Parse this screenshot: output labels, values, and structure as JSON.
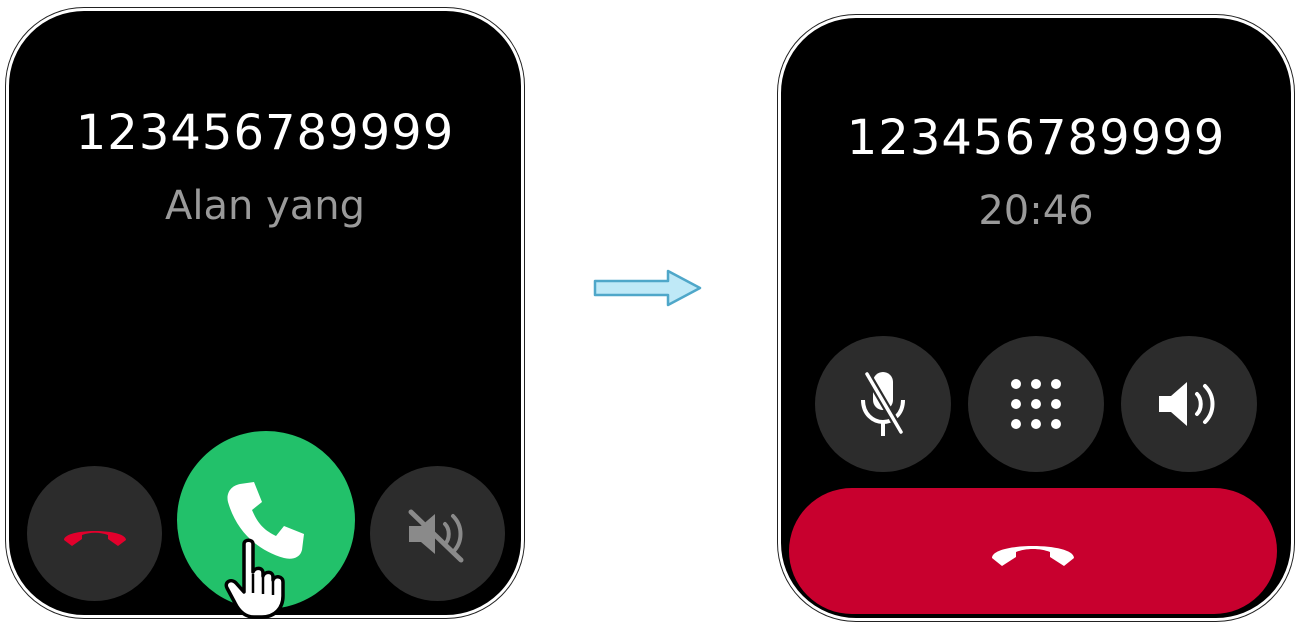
{
  "incoming_call": {
    "number": "123456789999",
    "caller_name": "Alan yang",
    "buttons": {
      "decline_icon": "phone-hangup-icon",
      "answer_icon": "phone-icon",
      "silence_icon": "speaker-muted-icon"
    }
  },
  "active_call": {
    "number": "123456789999",
    "duration": "20:46",
    "buttons": {
      "mute_icon": "microphone-muted-icon",
      "keypad_icon": "dialpad-icon",
      "speaker_icon": "speaker-icon",
      "end_call_icon": "phone-hangup-icon"
    }
  },
  "colors": {
    "screen_background": "#000000",
    "button_gray": "#2c2c2c",
    "answer_green": "#22c16a",
    "decline_red": "#e3002c",
    "end_call_red": "#c8002e",
    "secondary_text": "#9a9a9a",
    "arrow_fill": "#bfe9f7",
    "arrow_stroke": "#4fa7c9"
  },
  "overlay": {
    "pointer_icon": "hand-pointer-icon",
    "transition_icon": "arrow-right-icon"
  }
}
